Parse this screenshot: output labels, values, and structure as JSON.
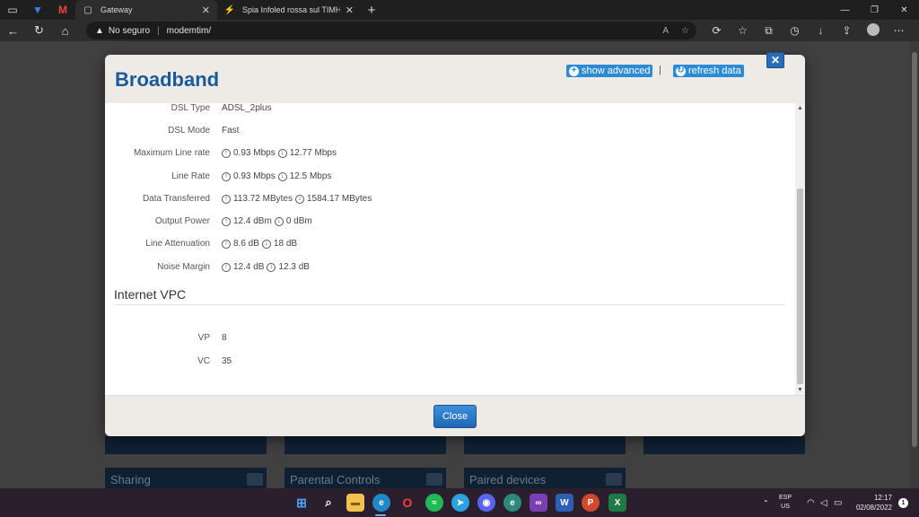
{
  "browser": {
    "tabs": [
      {
        "title": "Gateway",
        "active": true
      },
      {
        "title": "Spia Infoled rossa sul TIMHUB -",
        "active": false
      }
    ],
    "security_label": "No seguro",
    "url": "modemtim/",
    "close_tab_glyph": "✕",
    "new_tab_glyph": "+"
  },
  "background": {
    "cards": [
      "Sharing",
      "Parental Controls",
      "Paired devices"
    ]
  },
  "modal": {
    "title": "Broadband",
    "show_advanced": "show advanced",
    "refresh_data": "refresh data",
    "divider": "|",
    "close_icon": "✕",
    "rows": [
      {
        "label": "DSL Type",
        "value": "ADSL_2plus"
      },
      {
        "label": "DSL Mode",
        "value": "Fast"
      },
      {
        "label": "Maximum Line rate",
        "up": "0.93 Mbps",
        "down": "12.77 Mbps"
      },
      {
        "label": "Line Rate",
        "up": "0.93 Mbps",
        "down": "12.5 Mbps"
      },
      {
        "label": "Data Transferred",
        "up": "113.72 MBytes",
        "down": "1584.17 MBytes"
      },
      {
        "label": "Output Power",
        "up": "12.4 dBm",
        "down": "0 dBm"
      },
      {
        "label": "Line Attenuation",
        "up": "8.6 dB",
        "down": "18 dB"
      },
      {
        "label": "Noise Margin",
        "up": "12.4 dB",
        "down": "12.3 dB"
      }
    ],
    "section_title": "Internet VPC",
    "vpc": [
      {
        "label": "VP",
        "value": "8"
      },
      {
        "label": "VC",
        "value": "35"
      }
    ],
    "close_button": "Close"
  },
  "taskbar": {
    "lang_top": "ESP",
    "lang_bottom": "US",
    "time": "12:17",
    "date": "02/08/2022",
    "notification_count": "1",
    "apps": [
      "start-icon",
      "search-icon",
      "file-explorer-icon",
      "edge-icon",
      "opera-icon",
      "spotify-icon",
      "telegram-icon",
      "discord-icon",
      "edge-dev-icon",
      "visual-studio-icon",
      "word-icon",
      "powerpoint-icon",
      "excel-icon"
    ]
  },
  "colors": {
    "title_blue": "#1a5a99",
    "button_blue": "#2b8bd6",
    "taskbar": "#2b1e2d"
  }
}
